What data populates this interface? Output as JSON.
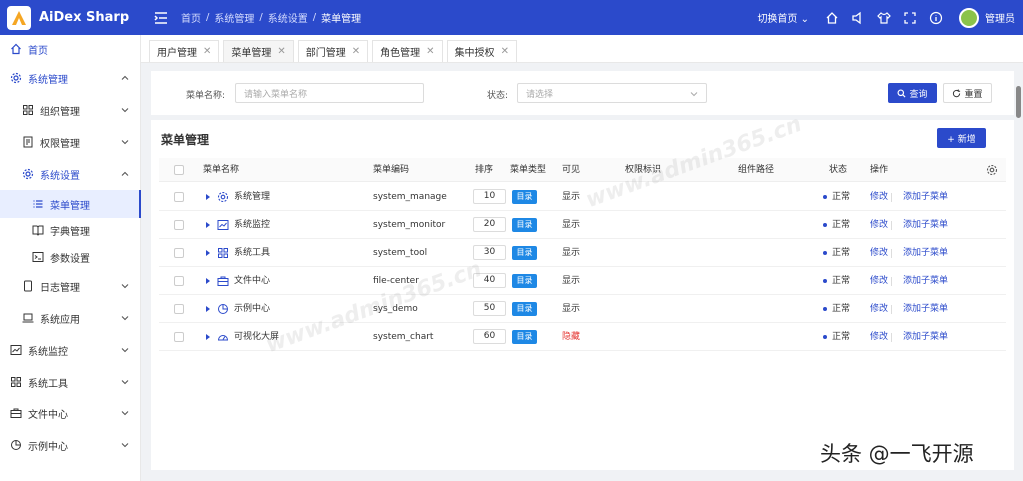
{
  "app": {
    "name": "AiDex Sharp",
    "switch_home": "切换首页",
    "username": "管理员"
  },
  "breadcrumb": [
    "首页",
    "系统管理",
    "系统设置",
    "菜单管理"
  ],
  "sidebar": {
    "items": [
      {
        "label": "首页",
        "icon": "home-icon"
      },
      {
        "label": "系统管理",
        "icon": "gear-icon"
      },
      {
        "label": "组织管理",
        "icon": "grid-icon"
      },
      {
        "label": "权限管理",
        "icon": "doc-icon"
      },
      {
        "label": "系统设置",
        "icon": "gear-icon"
      },
      {
        "label": "菜单管理",
        "icon": "list-icon"
      },
      {
        "label": "字典管理",
        "icon": "book-icon"
      },
      {
        "label": "参数设置",
        "icon": "terminal-icon"
      },
      {
        "label": "日志管理",
        "icon": "file-icon"
      },
      {
        "label": "系统应用",
        "icon": "laptop-icon"
      },
      {
        "label": "系统监控",
        "icon": "chart-icon"
      },
      {
        "label": "系统工具",
        "icon": "grid-icon"
      },
      {
        "label": "文件中心",
        "icon": "briefcase-icon"
      },
      {
        "label": "示例中心",
        "icon": "pie-icon"
      }
    ]
  },
  "tabs": [
    {
      "label": "用户管理"
    },
    {
      "label": "菜单管理"
    },
    {
      "label": "部门管理"
    },
    {
      "label": "角色管理"
    },
    {
      "label": "集中授权"
    }
  ],
  "search": {
    "name_label": "菜单名称:",
    "name_placeholder": "请输入菜单名称",
    "status_label": "状态:",
    "status_placeholder": "请选择",
    "query_label": "查询",
    "reset_label": "重置"
  },
  "table": {
    "title": "菜单管理",
    "add_label": "+ 新增",
    "columns": {
      "name": "菜单名称",
      "code": "菜单编码",
      "sort": "排序",
      "type": "菜单类型",
      "visible": "可见",
      "perm": "权限标识",
      "path": "组件路径",
      "status": "状态",
      "action": "操作"
    },
    "rows": [
      {
        "name": "系统管理",
        "icon": "gear-icon",
        "code": "system_manage",
        "sort": "10",
        "type": "目录",
        "visible": "显示",
        "status": "正常",
        "edit": "修改",
        "add_child": "添加子菜单"
      },
      {
        "name": "系统监控",
        "icon": "chart-icon",
        "code": "system_monitor",
        "sort": "20",
        "type": "目录",
        "visible": "显示",
        "status": "正常",
        "edit": "修改",
        "add_child": "添加子菜单"
      },
      {
        "name": "系统工具",
        "icon": "grid-icon",
        "code": "system_tool",
        "sort": "30",
        "type": "目录",
        "visible": "显示",
        "status": "正常",
        "edit": "修改",
        "add_child": "添加子菜单"
      },
      {
        "name": "文件中心",
        "icon": "briefcase-icon",
        "code": "file-center",
        "sort": "40",
        "type": "目录",
        "visible": "显示",
        "status": "正常",
        "edit": "修改",
        "add_child": "添加子菜单"
      },
      {
        "name": "示例中心",
        "icon": "pie-icon",
        "code": "sys_demo",
        "sort": "50",
        "type": "目录",
        "visible": "显示",
        "status": "正常",
        "edit": "修改",
        "add_child": "添加子菜单"
      },
      {
        "name": "可视化大屏",
        "icon": "gauge-icon",
        "code": "system_chart",
        "sort": "60",
        "type": "目录",
        "visible": "隐藏",
        "status": "正常",
        "edit": "修改",
        "add_child": "添加子菜单"
      }
    ]
  },
  "watermark": "www.admin365.cn",
  "footer_mark": "头条 @一飞开源",
  "colors": {
    "primary": "#2b4acb",
    "tag": "#1e88e5",
    "danger": "#e53935"
  }
}
